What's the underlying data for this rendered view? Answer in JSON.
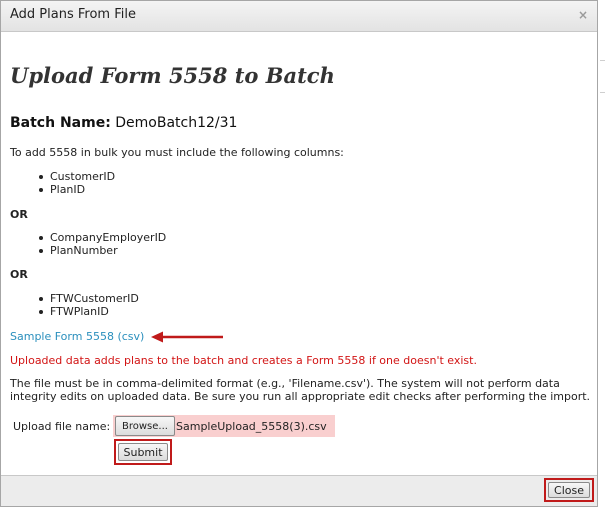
{
  "dialog": {
    "title": "Add Plans From File",
    "close_glyph": "×"
  },
  "heading": "Upload Form 5558 to Batch",
  "batch": {
    "label": "Batch Name:",
    "value": "DemoBatch12/31"
  },
  "intro": "To add 5558 in bulk you must include the following columns:",
  "column_groups": [
    [
      "CustomerID",
      "PlanID"
    ],
    [
      "CompanyEmployerID",
      "PlanNumber"
    ],
    [
      "FTWCustomerID",
      "FTWPlanID"
    ]
  ],
  "or_label": "OR",
  "sample_link": "Sample Form 5558 (csv)",
  "warning": "Uploaded data adds plans to the batch and creates a Form 5558 if one doesn't exist.",
  "format_note": "The file must be in comma-delimited format (e.g., 'Filename.csv'). The system will not perform data integrity edits on uploaded data. Be sure you run all appropriate edit checks after performing the import.",
  "upload": {
    "label": "Upload file name:",
    "browse_label": "Browse...",
    "file_name": "SampleUpload_5558(3).csv"
  },
  "submit_label": "Submit",
  "footer": {
    "close_label": "Close"
  },
  "colors": {
    "link": "#2a8fbd",
    "warning": "#d21414",
    "highlight_frame": "#c01a1a",
    "file_highlight": "#f9cfcf"
  },
  "icons": {
    "annotation": "left-arrow-icon",
    "dialog_close": "close-icon"
  }
}
